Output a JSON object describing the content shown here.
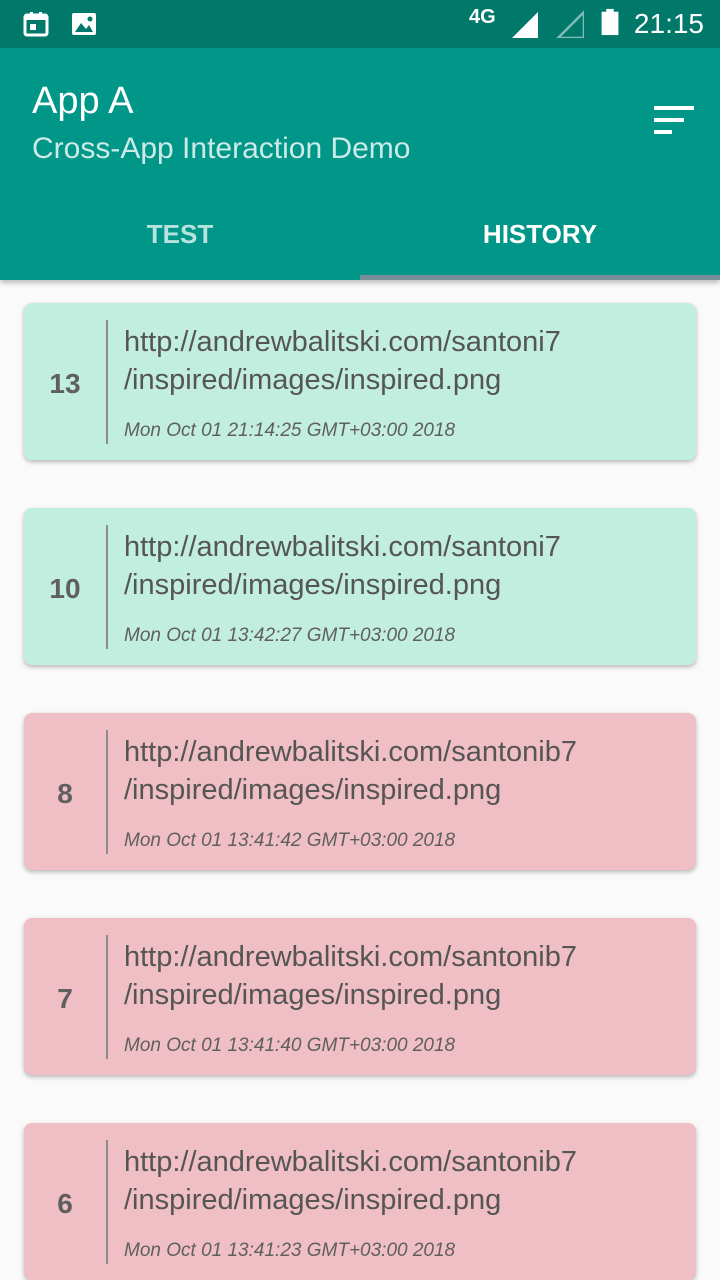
{
  "status_bar": {
    "network": "4G",
    "time": "21:15",
    "icons": [
      "calendar-icon",
      "image-icon",
      "signal-icon",
      "signal-empty-icon",
      "battery-icon"
    ]
  },
  "app_bar": {
    "title": "App A",
    "subtitle": "Cross-App Interaction Demo",
    "action_icon": "sort-icon"
  },
  "tabs": [
    {
      "label": "TEST",
      "selected": false
    },
    {
      "label": "HISTORY",
      "selected": true
    }
  ],
  "history": [
    {
      "id": "13",
      "url": "http://andrewbalitski.com/santoni7\n/inspired/images/inspired.png",
      "timestamp": "Mon Oct 01 21:14:25 GMT+03:00 2018",
      "status": "success"
    },
    {
      "id": "10",
      "url": "http://andrewbalitski.com/santoni7\n/inspired/images/inspired.png",
      "timestamp": "Mon Oct 01 13:42:27 GMT+03:00 2018",
      "status": "success"
    },
    {
      "id": "8",
      "url": "http://andrewbalitski.com/santonib7\n/inspired/images/inspired.png",
      "timestamp": "Mon Oct 01 13:41:42 GMT+03:00 2018",
      "status": "error"
    },
    {
      "id": "7",
      "url": "http://andrewbalitski.com/santonib7\n/inspired/images/inspired.png",
      "timestamp": "Mon Oct 01 13:41:40 GMT+03:00 2018",
      "status": "error"
    },
    {
      "id": "6",
      "url": "http://andrewbalitski.com/santonib7\n/inspired/images/inspired.png",
      "timestamp": "Mon Oct 01 13:41:23 GMT+03:00 2018",
      "status": "error"
    }
  ],
  "colors": {
    "status_bar": "#00796b",
    "app_bar": "#009688",
    "success_card": "#c2eee0",
    "error_card": "#f0bfc5",
    "tab_indicator": "#78909c"
  }
}
